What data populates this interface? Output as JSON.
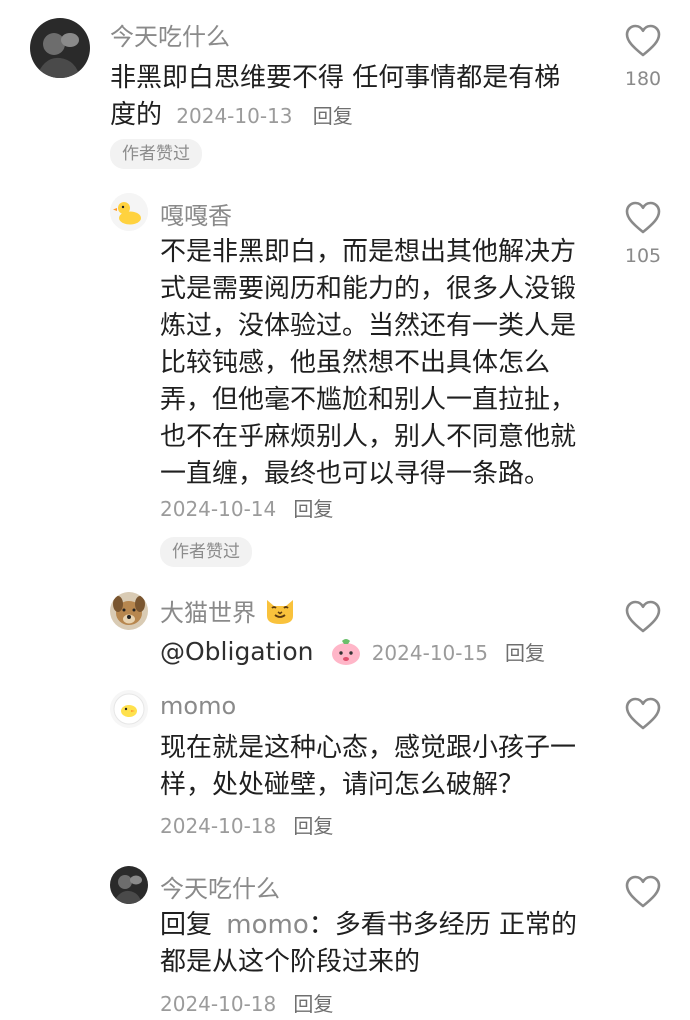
{
  "comments": [
    {
      "username": "今天吃什么",
      "text_lines": [
        "非黑即白思维要不得 任何事情都是有梯",
        "度的"
      ],
      "date": "2024-10-13",
      "reply_label": "回复",
      "badge": "作者赞过",
      "like_count": "180",
      "avatar_icon": "portrait-avatar"
    },
    {
      "username": "嘎嘎香",
      "text_lines": [
        "不是非黑即白，而是想出其他解决方",
        "式是需要阅历和能力的，很多人没锻",
        "炼过，没体验过。当然还有一类人是",
        "比较钝感，他虽然想不出具体怎么",
        "弄，但他毫不尴尬和别人一直拉扯，",
        "也不在乎麻烦别人，别人不同意他就",
        "一直缠，最终也可以寻得一条路。"
      ],
      "date": "2024-10-14",
      "reply_label": "回复",
      "badge": "作者赞过",
      "like_count": "105",
      "avatar_icon": "duck-avatar"
    },
    {
      "username": "大猫世界",
      "username_emoji": "cat-face-emoji",
      "mention": "@Obligation",
      "sticker_icon": "pink-bun-sticker",
      "date": "2024-10-15",
      "reply_label": "回复",
      "avatar_icon": "dog-avatar"
    },
    {
      "username": "momo",
      "text_lines": [
        "现在就是这种心态，感觉跟小孩子一",
        "样，处处碰壁，请问怎么破解？"
      ],
      "date": "2024-10-18",
      "reply_label": "回复",
      "avatar_icon": "chick-avatar"
    },
    {
      "username": "今天吃什么",
      "reply_prefix": "回复",
      "reply_to": "momo",
      "reply_colon": "：",
      "text_first": "多看书多经历 正常的",
      "text_second": "都是从这个阶段过来的",
      "date": "2024-10-18",
      "reply_label": "回复",
      "avatar_icon": "portrait-avatar"
    }
  ],
  "colors": {
    "background": "#ffffff",
    "text": "#1f1f1f",
    "meta": "#9b9b9b",
    "badge_bg": "#f2f2f2",
    "like_icon": "#8a8a8a"
  }
}
